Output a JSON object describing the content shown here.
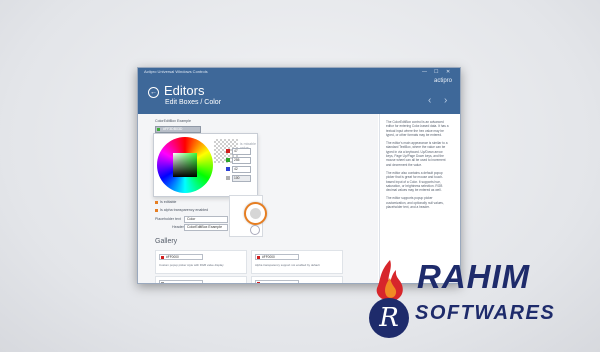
{
  "window": {
    "title": "Actipro Universal Windows Controls",
    "controls": {
      "minimize": "—",
      "maximize": "☐",
      "close": "✕"
    }
  },
  "header": {
    "title": "Editors",
    "subtitle": "Edit Boxes / Color",
    "brand": "actipro",
    "back_icon": "←",
    "prev_icon": "‹",
    "next_icon": "›"
  },
  "demo": {
    "label": "ColorEditBox Example",
    "value": "#FF3DB03D",
    "channels": [
      {
        "value": "47",
        "color": "#d21e1e"
      },
      {
        "value": "255",
        "color": "#2aa52a"
      },
      {
        "value": "42",
        "color": "#2b3fd6"
      },
      {
        "value": "100",
        "color": "#b0b0b0"
      }
    ],
    "popup_hint": "is mixable value",
    "options": [
      "Is editable",
      "Is alpha transparency enabled"
    ],
    "placeholder_label": "Placeholder text",
    "placeholder_value": "Color",
    "header_label": "Header",
    "header_value": "ColorEditBox Example"
  },
  "gallery": {
    "title": "Gallery",
    "cards": [
      {
        "value": "#FF0000",
        "caption": "Custom popup picker style with RGB value display"
      },
      {
        "value": "#FF0000",
        "caption": "Alpha transparency support not enabled by default"
      },
      {
        "value": "",
        "caption": ""
      },
      {
        "value": "",
        "caption": ""
      }
    ]
  },
  "description": [
    "The ColorEditBox control is an advanced editor for entering Color-based data. It has a textual input where the hex value may be typed, or other formats may be entered.",
    "The editor's main appearance is similar to a standard TextBox, where the value can be typed in via a keyboard. Up/Down arrow keys, Page Up/Page Down keys, and the mouse wheel can all be used to increment and decrement the value.",
    "The editor also contains a default popup picker that is great for mouse and touch-based input of a Color. It supports hue, saturation, or brightness selection. RGB decimal values may be entered as well.",
    "The editor supports popup picker customization, and optionally null values, placeholder text, and a header."
  ],
  "watermark": {
    "line1": "RAHIM",
    "line2": "SOFTWARES",
    "badge": "R"
  }
}
